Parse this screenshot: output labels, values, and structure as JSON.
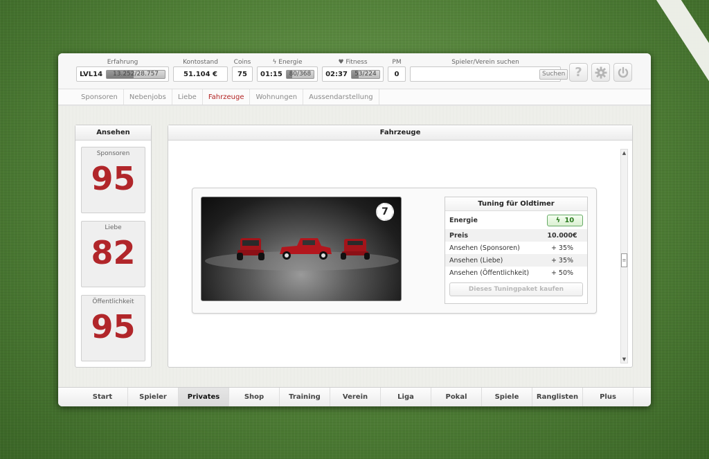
{
  "stats": {
    "erfahrung": {
      "label": "Erfahrung",
      "level": "LVL14",
      "progress_text": "13.252/28.757",
      "progress": 0.46
    },
    "kontostand": {
      "label": "Kontostand",
      "value": "51.104 €"
    },
    "coins": {
      "label": "Coins",
      "value": "75"
    },
    "energie": {
      "label": "Energie",
      "time": "01:15",
      "progress_text": "80/368",
      "progress": 0.22
    },
    "fitness": {
      "label": "Fitness",
      "time": "02:37",
      "progress_text": "53/224",
      "progress": 0.24
    },
    "pm": {
      "label": "PM",
      "value": "0"
    }
  },
  "search": {
    "label": "Spieler/Verein suchen",
    "placeholder": "",
    "button": "Suchen"
  },
  "toolbar": {
    "help": "?",
    "settings_icon": "gear-icon",
    "power_icon": "power-icon"
  },
  "subnav": [
    {
      "label": "Sponsoren"
    },
    {
      "label": "Nebenjobs"
    },
    {
      "label": "Liebe"
    },
    {
      "label": "Fahrzeuge",
      "active": true
    },
    {
      "label": "Wohnungen"
    },
    {
      "label": "Aussendarstellung"
    }
  ],
  "ansehen": {
    "title": "Ansehen",
    "items": [
      {
        "name": "Sponsoren",
        "value": "95"
      },
      {
        "name": "Liebe",
        "value": "82"
      },
      {
        "name": "Öffentlichkeit",
        "value": "95"
      }
    ]
  },
  "main": {
    "title": "Fahrzeuge",
    "card": {
      "badge": "7",
      "tuning": {
        "title": "Tuning für Oldtimer",
        "energie_label": "Energie",
        "energie_value": "10",
        "preis_label": "Preis",
        "preis_value": "10.000€",
        "rows": [
          {
            "label": "Ansehen (Sponsoren)",
            "value": "+ 35%"
          },
          {
            "label": "Ansehen (Liebe)",
            "value": "+ 35%"
          },
          {
            "label": "Ansehen (Öffentlichkeit)",
            "value": "+ 50%"
          }
        ],
        "buy_label": "Dieses Tuningpaket kaufen"
      }
    }
  },
  "bottomnav": [
    {
      "label": "Start"
    },
    {
      "label": "Spieler"
    },
    {
      "label": "Privates",
      "active": true
    },
    {
      "label": "Shop"
    },
    {
      "label": "Training"
    },
    {
      "label": "Verein"
    },
    {
      "label": "Liga"
    },
    {
      "label": "Pokal"
    },
    {
      "label": "Spiele"
    },
    {
      "label": "Ranglisten"
    },
    {
      "label": "Plus"
    }
  ],
  "colors": {
    "accent_red": "#b1262a",
    "energy_green": "#2b7a1f"
  }
}
